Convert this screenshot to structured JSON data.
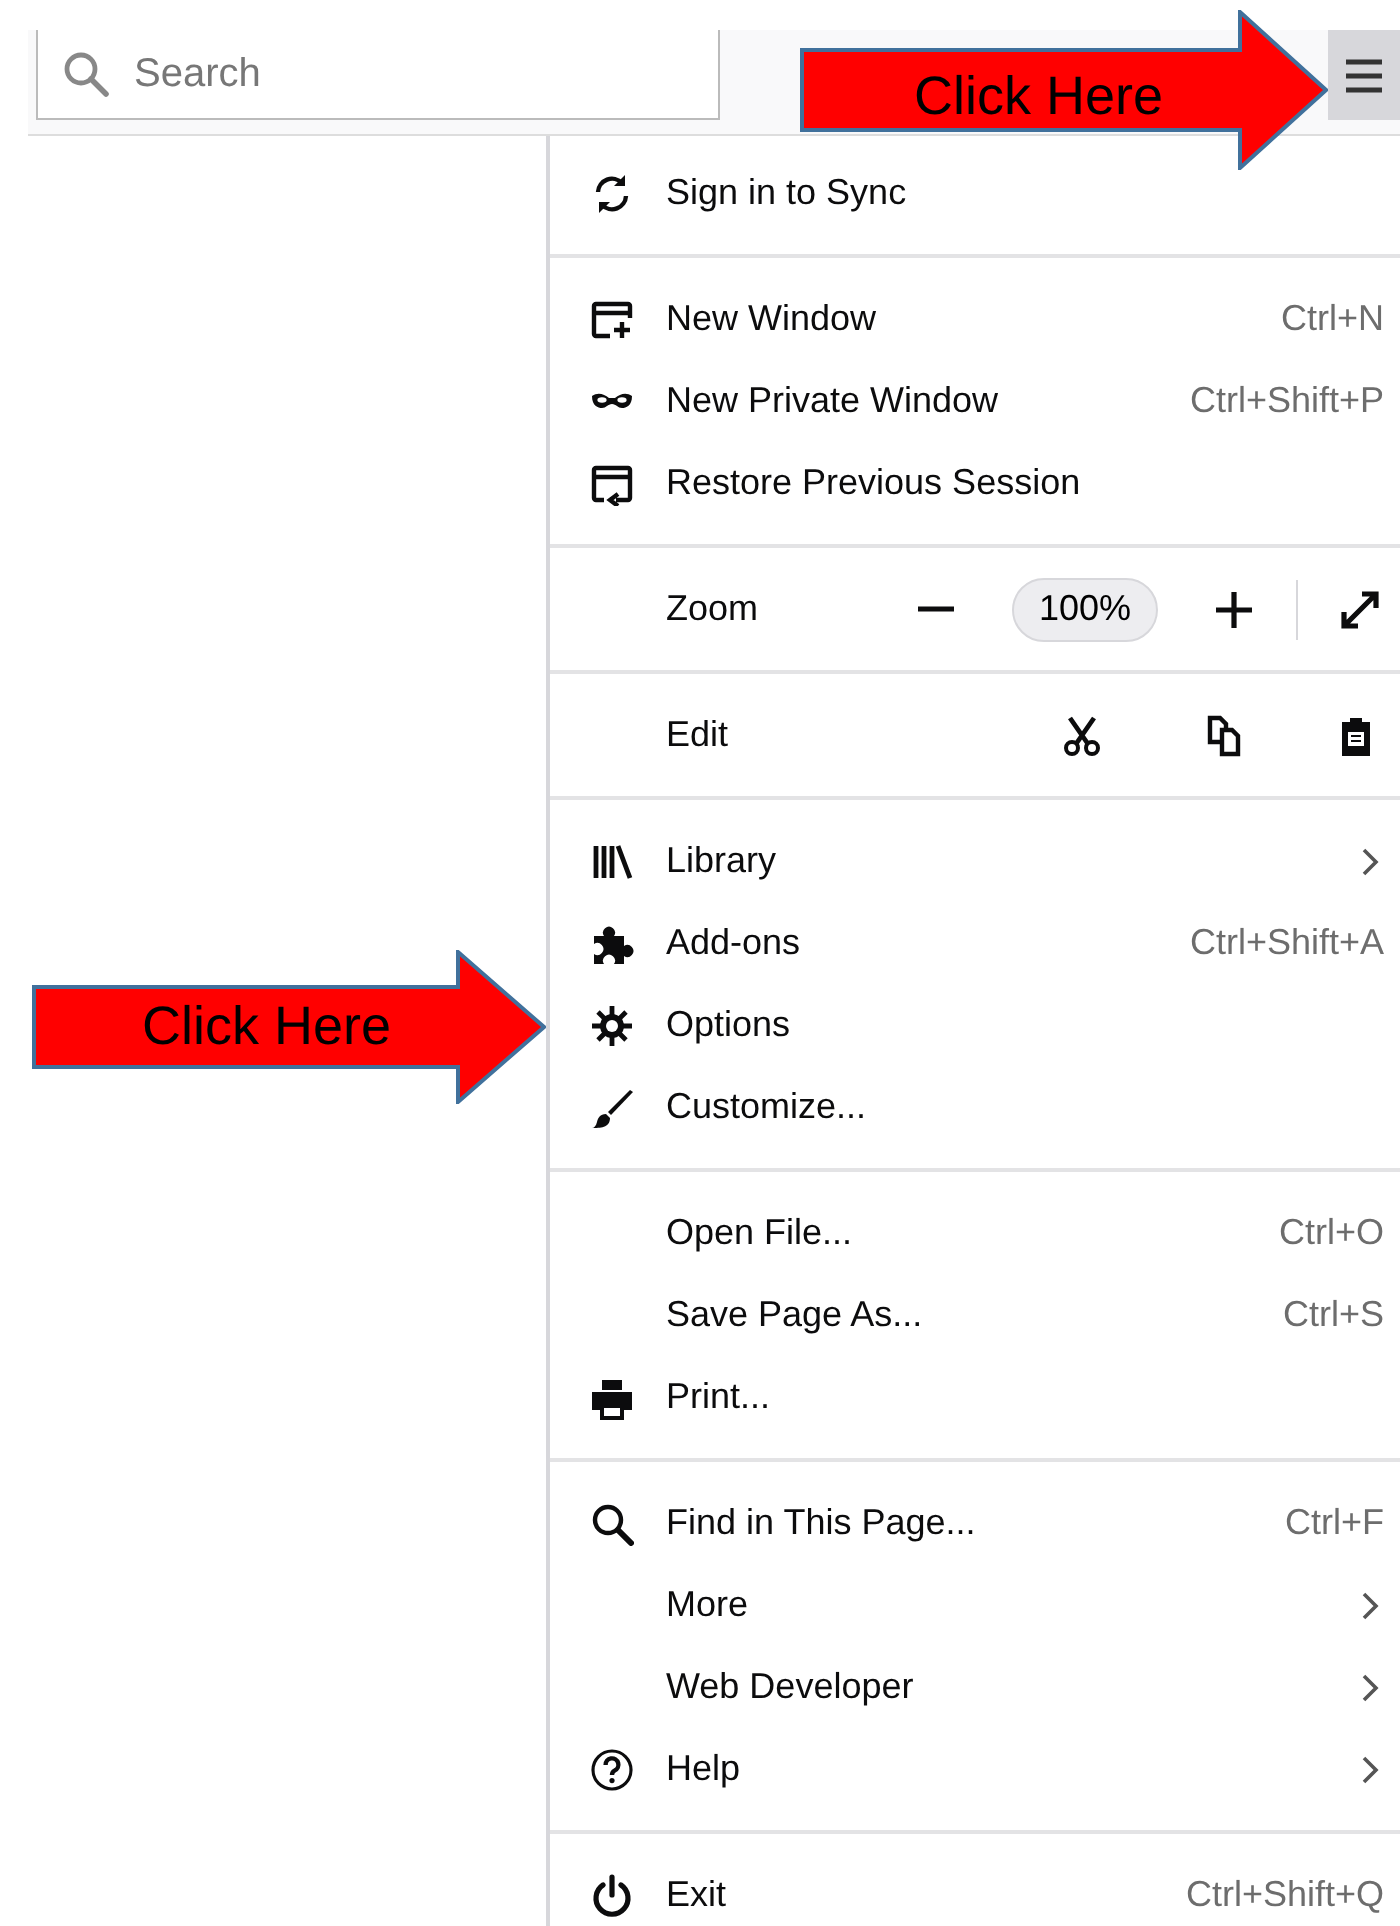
{
  "toolbar": {
    "search": {
      "placeholder": "Search"
    }
  },
  "menu": {
    "sections": [
      {
        "items": [
          {
            "kind": "item",
            "label": "Sign in to Sync"
          }
        ]
      },
      {
        "items": [
          {
            "kind": "item",
            "label": "New Window",
            "shortcut": "Ctrl+N"
          },
          {
            "kind": "item",
            "label": "New Private Window",
            "shortcut": "Ctrl+Shift+P"
          },
          {
            "kind": "item",
            "label": "Restore Previous Session"
          }
        ]
      },
      {
        "items": [
          {
            "kind": "zoom",
            "label": "Zoom",
            "value": "100%"
          }
        ]
      },
      {
        "items": [
          {
            "kind": "edit",
            "label": "Edit"
          }
        ]
      },
      {
        "items": [
          {
            "kind": "item",
            "label": "Library",
            "submenu": true
          },
          {
            "kind": "item",
            "label": "Add-ons",
            "shortcut": "Ctrl+Shift+A"
          },
          {
            "kind": "item",
            "label": "Options"
          },
          {
            "kind": "item",
            "label": "Customize..."
          }
        ]
      },
      {
        "items": [
          {
            "kind": "item",
            "label": "Open File...",
            "shortcut": "Ctrl+O"
          },
          {
            "kind": "item",
            "label": "Save Page As...",
            "shortcut": "Ctrl+S"
          },
          {
            "kind": "item",
            "label": "Print..."
          }
        ]
      },
      {
        "items": [
          {
            "kind": "item",
            "label": "Find in This Page...",
            "shortcut": "Ctrl+F"
          },
          {
            "kind": "item",
            "label": "More",
            "submenu": true
          },
          {
            "kind": "item",
            "label": "Web Developer",
            "submenu": true
          },
          {
            "kind": "item",
            "label": "Help",
            "submenu": true
          }
        ]
      },
      {
        "items": [
          {
            "kind": "item",
            "label": "Exit",
            "shortcut": "Ctrl+Shift+Q"
          }
        ]
      }
    ]
  },
  "callouts": [
    {
      "text": "Click Here"
    },
    {
      "text": "Click Here"
    }
  ]
}
